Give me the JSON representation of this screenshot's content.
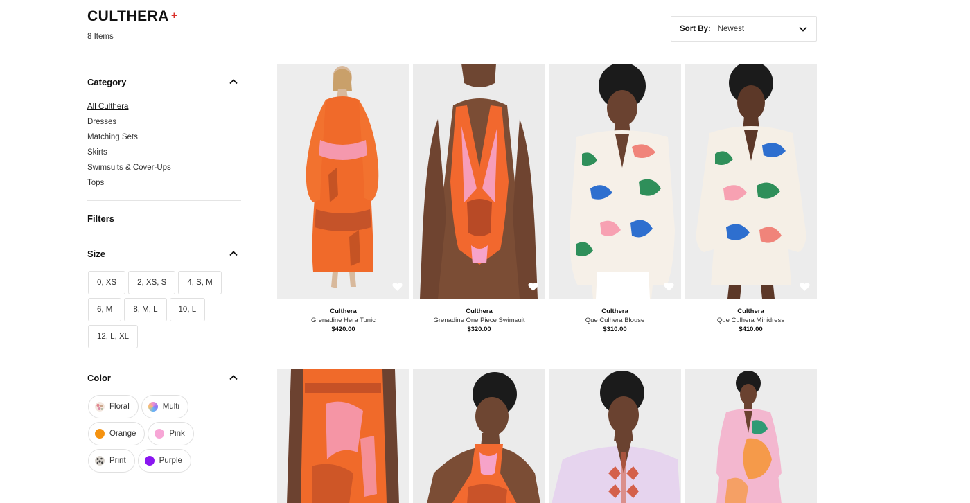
{
  "header": {
    "brand": "CULTHERA",
    "brand_mark": "+",
    "count": "8 Items"
  },
  "sort": {
    "label": "Sort By:",
    "value": "Newest"
  },
  "category": {
    "title": "Category",
    "items": [
      {
        "label": "All Culthera",
        "active": true
      },
      {
        "label": "Dresses"
      },
      {
        "label": "Matching Sets"
      },
      {
        "label": "Skirts"
      },
      {
        "label": "Swimsuits & Cover-Ups"
      },
      {
        "label": "Tops"
      }
    ]
  },
  "filters": {
    "title": "Filters"
  },
  "size": {
    "title": "Size",
    "options": [
      "0, XS",
      "2, XS, S",
      "4, S, M",
      "6, M",
      "8, M, L",
      "10, L",
      "12, L, XL"
    ]
  },
  "color": {
    "title": "Color",
    "options": [
      {
        "label": "Floral",
        "swatch": "floral"
      },
      {
        "label": "Multi",
        "swatch": "multi"
      },
      {
        "label": "Orange",
        "swatch": "#f5920f"
      },
      {
        "label": "Pink",
        "swatch": "#f7a6d6"
      },
      {
        "label": "Print",
        "swatch": "print"
      },
      {
        "label": "Purple",
        "swatch": "#8a16f0"
      }
    ]
  },
  "products": [
    {
      "brand": "Culthera",
      "name": "Grenadine Hera Tunic",
      "price": "$420.00",
      "image": "orange-tunic-photo"
    },
    {
      "brand": "Culthera",
      "name": "Grenadine One Piece Swimsuit",
      "price": "$320.00",
      "image": "orange-swimsuit-photo"
    },
    {
      "brand": "Culthera",
      "name": "Que Culhera Blouse",
      "price": "$310.00",
      "image": "printed-blouse-photo"
    },
    {
      "brand": "Culthera",
      "name": "Que Culhera Minidress",
      "price": "$410.00",
      "image": "printed-minidress-photo"
    },
    {
      "image": "orange-skirt-photo"
    },
    {
      "image": "orange-halter-top-photo"
    },
    {
      "image": "lilac-blouse-photo"
    },
    {
      "image": "pink-dress-photo"
    }
  ],
  "colors": {
    "accent": "#d9302a",
    "border": "#e0e0e0"
  }
}
